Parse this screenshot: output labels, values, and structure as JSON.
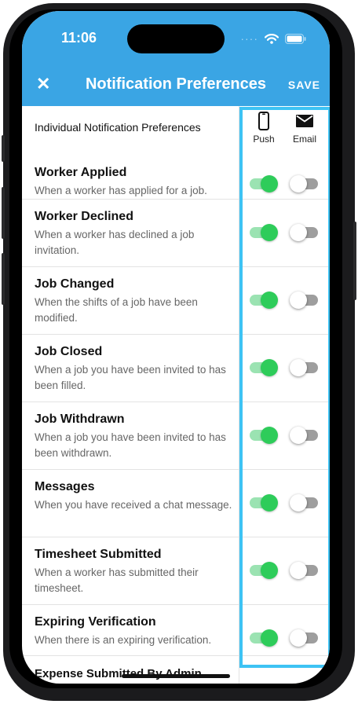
{
  "status": {
    "time": "11:06"
  },
  "header": {
    "close_icon": "x-icon",
    "title": "Notification Preferences",
    "save_label": "SAVE"
  },
  "colors": {
    "header_bg": "#3aa5e4",
    "toggle_on": "#2ecc5a",
    "highlight": "#3ec3f4"
  },
  "prefs": {
    "section_label": "Individual Notification Preferences",
    "columns": [
      {
        "label": "Push",
        "icon": "phone-icon"
      },
      {
        "label": "Email",
        "icon": "envelope-icon"
      }
    ],
    "items": [
      {
        "title": "Worker Applied",
        "desc": "When a worker has applied for a job.",
        "push": true,
        "email": false
      },
      {
        "title": "Worker Declined",
        "desc": "When a worker has declined a job invitation.",
        "push": true,
        "email": false
      },
      {
        "title": "Job Changed",
        "desc": "When the shifts of a job have been modified.",
        "push": true,
        "email": false
      },
      {
        "title": "Job Closed",
        "desc": "When a job you have been invited to has been filled.",
        "push": true,
        "email": false
      },
      {
        "title": "Job Withdrawn",
        "desc": "When a job you have been invited to has been withdrawn.",
        "push": true,
        "email": false
      },
      {
        "title": "Messages",
        "desc": "When you have received a chat message.",
        "push": true,
        "email": false
      },
      {
        "title": "Timesheet Submitted",
        "desc": "When a worker has submitted their timesheet.",
        "push": true,
        "email": false
      },
      {
        "title": "Expiring Verification",
        "desc": "When there is an expiring verification.",
        "push": true,
        "email": false
      }
    ],
    "partial_item_title": "Expense Submitted By Admin"
  }
}
